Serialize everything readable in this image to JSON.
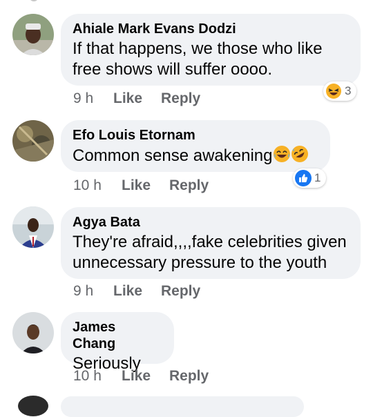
{
  "comments": [
    {
      "author": "Ahiale Mark Evans Dodzi",
      "text": "If that happens, we those who like free shows will suffer oooo.",
      "time": "9 h",
      "like": "Like",
      "reply": "Reply",
      "reaction": {
        "icon": "haha-emoji-icon",
        "count": "3"
      }
    },
    {
      "author": "Efo Louis Etornam",
      "text": "Common sense awakening",
      "time": "10 h",
      "like": "Like",
      "reply": "Reply",
      "reaction": {
        "icon": "like-thumb-icon",
        "count": "1"
      }
    },
    {
      "author": "Agya Bata",
      "text": "They're afraid,,,,fake celebrities given unnecessary pressure to the youth",
      "time": "9 h",
      "like": "Like",
      "reply": "Reply"
    },
    {
      "author": "James Chang",
      "text": "Seriously",
      "time": "10 h",
      "like": "Like",
      "reply": "Reply"
    }
  ],
  "colors": {
    "bubble": "#f0f2f5",
    "meta": "#65676b",
    "like_blue": "#1877f2",
    "haha_yellow": "#f7b125"
  }
}
